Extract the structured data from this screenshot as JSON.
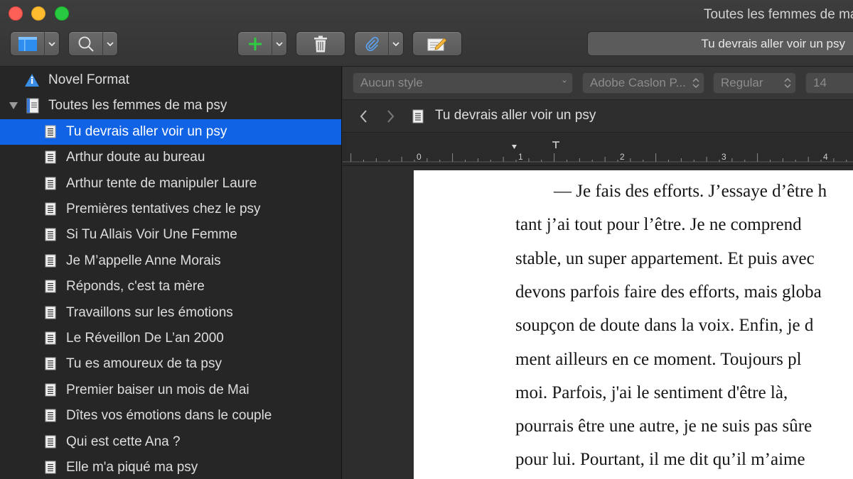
{
  "window": {
    "title": "Toutes les femmes de ma psy",
    "controls": [
      "close",
      "minimize",
      "zoom"
    ]
  },
  "toolbar": {
    "view_icon": "sidebar-view-icon",
    "search_icon": "search-icon",
    "add_icon": "plus-icon",
    "trash_icon": "trash-icon",
    "attach_icon": "paperclip-icon",
    "compose_icon": "compose-icon",
    "current_doc": "Tu devrais aller voir un psy"
  },
  "binder": {
    "items": [
      {
        "label": "Novel Format",
        "icon": "info-icon",
        "level": 0
      },
      {
        "label": "Toutes les femmes de ma psy",
        "icon": "manuscript-icon",
        "level": 0,
        "expanded": true
      },
      {
        "label": "Tu devrais aller voir un psy",
        "icon": "page-icon",
        "level": 1,
        "selected": true
      },
      {
        "label": "Arthur doute au bureau",
        "icon": "page-icon",
        "level": 1
      },
      {
        "label": "Arthur tente de manipuler Laure",
        "icon": "page-icon",
        "level": 1
      },
      {
        "label": "Premières tentatives chez le psy",
        "icon": "page-icon",
        "level": 1
      },
      {
        "label": "Si Tu Allais Voir Une Femme",
        "icon": "page-icon",
        "level": 1
      },
      {
        "label": "Je M’appelle Anne Morais",
        "icon": "page-icon",
        "level": 1
      },
      {
        "label": "Réponds, c'est ta mère",
        "icon": "page-icon",
        "level": 1
      },
      {
        "label": "Travaillons sur les émotions",
        "icon": "page-icon",
        "level": 1
      },
      {
        "label": "Le Réveillon De L’an 2000",
        "icon": "page-icon",
        "level": 1
      },
      {
        "label": "Tu es amoureux de ta psy",
        "icon": "page-icon",
        "level": 1
      },
      {
        "label": "Premier baiser un mois de Mai",
        "icon": "page-icon",
        "level": 1
      },
      {
        "label": "Dîtes vos émotions dans le couple",
        "icon": "page-icon",
        "level": 1
      },
      {
        "label": "Qui est cette Ana ?",
        "icon": "page-icon",
        "level": 1
      },
      {
        "label": "Elle m'a piqué ma psy",
        "icon": "page-icon",
        "level": 1
      }
    ]
  },
  "format_bar": {
    "style": "Aucun style",
    "font": "Adobe Caslon P...",
    "weight": "Regular",
    "size": "14"
  },
  "editor_header": {
    "title": "Tu devrais aller voir un psy"
  },
  "ruler": {
    "labels": [
      "0",
      "1",
      "2",
      "3",
      "4"
    ]
  },
  "document": {
    "lines": [
      "— Je fais des efforts. J’essaye d’être h",
      "tant j’ai tout pour l’être. Je ne comprend",
      "stable, un super appartement. Et puis avec",
      "devons parfois faire des efforts, mais globa",
      "soupçon de doute dans la voix. Enfin, je d",
      "ment ailleurs en ce moment. Toujours pl",
      "moi. Parfois, j'ai le sentiment d'être là,",
      "pourrais être une autre, je ne suis pas sûre",
      "pour lui. Pourtant, il me dit qu’il m’aime"
    ]
  },
  "colors": {
    "selection": "#1163e6",
    "add_green": "#2ecc40",
    "info_blue": "#3a8ee6"
  }
}
